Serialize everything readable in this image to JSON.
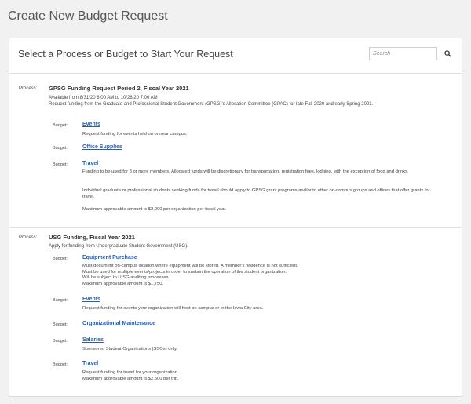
{
  "page_title": "Create New Budget Request",
  "panel": {
    "title": "Select a Process or Budget to Start Your Request",
    "search_placeholder": "Search",
    "search_icon": "search-icon"
  },
  "process_label": "Process:",
  "budget_label": "Budget:",
  "processes": [
    {
      "title": "GPSG Funding Request Period 2, Fiscal Year 2021",
      "availability": "Available from 8/31/20 8:00 AM to 10/26/20 7:00 AM",
      "description": "Request funding from the Graduate and Professional Student Government (GPSG)'s Allocation Committee (GPAC) for late Fall 2020 and early Spring 2021.",
      "budgets": [
        {
          "name": "Events",
          "description": "Request funding for events held on or near campus."
        },
        {
          "name": "Office Supplies",
          "description": ""
        },
        {
          "name": "Travel",
          "description": "Funding to be used for 3 or more members. Allocated funds will be discretionary for transportation, registration fees, lodging, with the exception of food and drinks.",
          "description2": "Individual graduate or professional students seeking funds for travel should apply to GPSG grant programs and/or to other on-campus groups and offices that offer grants for travel.",
          "description3": "Maximum approvable amount is $2,000 per organization per fiscal year."
        }
      ]
    },
    {
      "title": "USG Funding, Fiscal Year 2021",
      "availability": "",
      "description": "Apply for funding from Undergraduate Student Government (USG).",
      "budgets": [
        {
          "name": "Equipment Purchase",
          "description": "Must document on-campus location where equipment will be stored. A member's residence is not sufficient.",
          "description2": "Must be used for multiple events/projects in order to sustain the operation of the student organization.",
          "description3": "Will be subject to UISG auditing processes.",
          "description4": "Maximum approvable amount is $1,750."
        },
        {
          "name": "Events",
          "description": "Request funding for events your organization will host on campus or in the Iowa City area."
        },
        {
          "name": "Organizational Maintenance",
          "description": ""
        },
        {
          "name": "Salaries",
          "description": "Sponsored Student Organizations (SSOs) only."
        },
        {
          "name": "Travel",
          "description": "Request funding for travel for your organization.",
          "description2": "Maximum approvable amount is $2,500 per trip."
        }
      ]
    }
  ]
}
